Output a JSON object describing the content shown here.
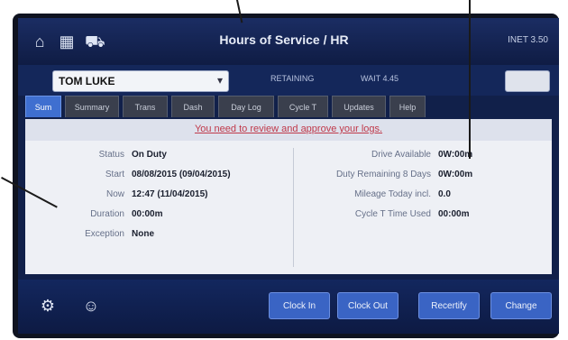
{
  "header": {
    "title": "Hours of Service / HR",
    "status": "INET 3.50",
    "home_icon": "home-icon",
    "grid_icon": "grid-icon",
    "truck_icon": "truck-icon"
  },
  "subbar": {
    "driver_value": "TOM LUKE",
    "driver_icon": "chevron-down-icon",
    "info_left": "RETAINING",
    "info_right": "WAIT 4.45"
  },
  "tabs": [
    {
      "label": "Sum"
    },
    {
      "label": "Summary"
    },
    {
      "label": "Trans"
    },
    {
      "label": "Dash"
    },
    {
      "label": "Day Log"
    },
    {
      "label": "Cycle T"
    },
    {
      "label": "Updates"
    },
    {
      "label": "Help"
    }
  ],
  "alert": {
    "text": "You need to review and approve your logs."
  },
  "left_fields": [
    {
      "label": "Status",
      "value": "On Duty"
    },
    {
      "label": "Start",
      "value": "08/08/2015 (09/04/2015)"
    },
    {
      "label": "Now",
      "value": "12:47 (11/04/2015)"
    },
    {
      "label": "Duration",
      "value": "00:00m"
    },
    {
      "label": "Exception",
      "value": "None"
    }
  ],
  "right_fields": [
    {
      "label": "Drive Available",
      "value": "0W:00m"
    },
    {
      "label": "Duty Remaining 8 Days",
      "value": "0W:00m"
    },
    {
      "label": "Mileage Today incl.",
      "value": "0.0"
    },
    {
      "label": "Cycle T Time Used",
      "value": "00:00m"
    }
  ],
  "footer": {
    "settings_icon": "gear-icon",
    "user_icon": "user-icon",
    "buttons": [
      {
        "label": "Clock In"
      },
      {
        "label": "Clock Out"
      },
      {
        "label": "Recertify"
      },
      {
        "label": "Change"
      }
    ]
  },
  "colors": {
    "header_bg": "#1b2d63",
    "active_tab": "#3f6fd0",
    "alert_text": "#c0394a",
    "footer_button": "#3a64c4"
  }
}
